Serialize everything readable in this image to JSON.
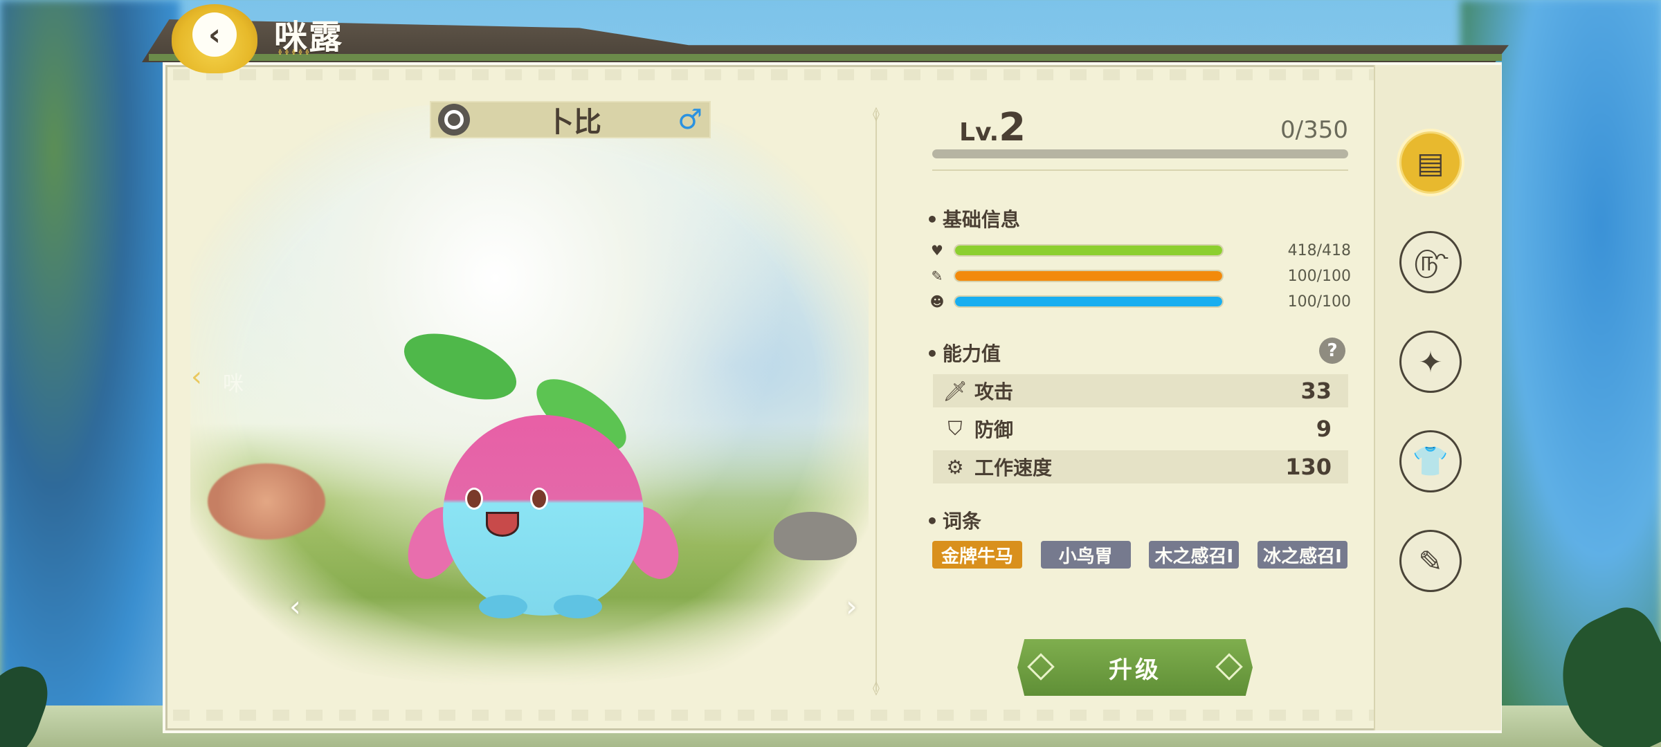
{
  "header": {
    "title": "咪露",
    "deco": "ᶲᶲᶲᶲᶲ",
    "back_glyph": "‹"
  },
  "pet": {
    "name": "卜比",
    "gender_symbol": "♂",
    "prev_arrow": "‹",
    "next_arrow": "›",
    "side_prev_glyph": "‹",
    "side_prev_ghost": "咪"
  },
  "level": {
    "label": "Lv.",
    "value": "2",
    "exp_text": "0/350",
    "exp_fraction": 0
  },
  "basic_info": {
    "title": "基础信息",
    "stats": [
      {
        "icon": "heart-icon",
        "glyph": "♥",
        "value_text": "418/418",
        "fraction": 1.0,
        "color": "#8ccf2f"
      },
      {
        "icon": "bread-icon",
        "glyph": "✎",
        "value_text": "100/100",
        "fraction": 1.0,
        "color": "#f28a0c"
      },
      {
        "icon": "smiley-icon",
        "glyph": "☻",
        "value_text": "100/100",
        "fraction": 1.0,
        "color": "#18aef0"
      }
    ]
  },
  "abilities": {
    "title": "能力值",
    "help_glyph": "?",
    "rows": [
      {
        "icon": "sword-icon",
        "glyph": "🗡",
        "label": "攻击",
        "value": "33"
      },
      {
        "icon": "shield-icon",
        "glyph": "⛉",
        "label": "防御",
        "value": "9"
      },
      {
        "icon": "gear-icon",
        "glyph": "⚙",
        "label": "工作速度",
        "value": "130"
      }
    ]
  },
  "traits": {
    "title": "词条",
    "tags": [
      {
        "label": "金牌牛马",
        "color": "#d9901c"
      },
      {
        "label": "小鸟胃",
        "color": "#767a8e"
      },
      {
        "label": "木之感召I",
        "color": "#767a8e"
      },
      {
        "label": "冰之感召I",
        "color": "#767a8e"
      }
    ]
  },
  "upgrade": {
    "label": "升级"
  },
  "sidebar": {
    "buttons": [
      {
        "icon": "profile-card-icon",
        "glyph": "▤",
        "active": true
      },
      {
        "icon": "skill-swirl-icon",
        "glyph": "௹",
        "active": false
      },
      {
        "icon": "sparkle-icon",
        "glyph": "✦",
        "active": false
      },
      {
        "icon": "shirt-icon",
        "glyph": "👕",
        "active": false
      },
      {
        "icon": "edit-note-icon",
        "glyph": "✎",
        "active": false
      }
    ]
  }
}
